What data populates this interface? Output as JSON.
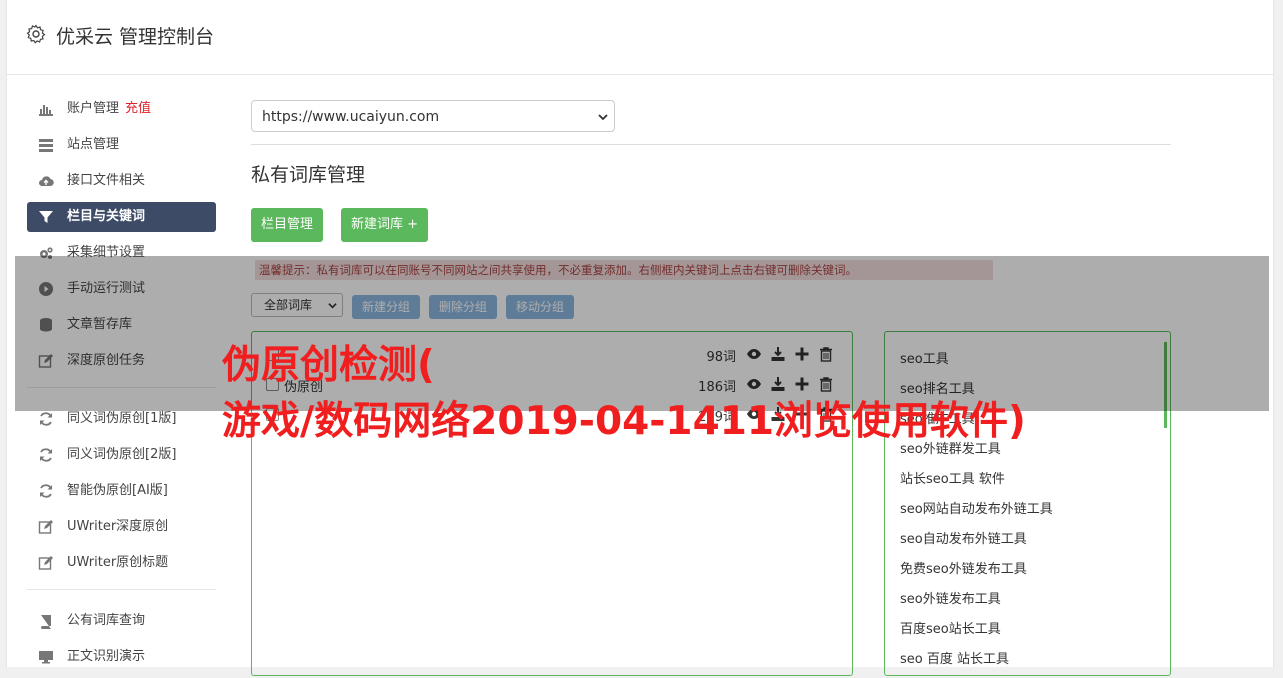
{
  "header": {
    "title": "优采云 管理控制台"
  },
  "sidebar": {
    "items": [
      {
        "label": "账户管理",
        "badge": "充值",
        "icon": "bar-chart-icon"
      },
      {
        "label": "站点管理",
        "icon": "server-icon"
      },
      {
        "label": "接口文件相关",
        "icon": "cloud-upload-icon"
      },
      {
        "label": "栏目与关键词",
        "icon": "filter-icon",
        "active": true
      },
      {
        "label": "采集细节设置",
        "icon": "gears-icon"
      },
      {
        "label": "手动运行测试",
        "icon": "play-circle-icon"
      },
      {
        "label": "文章暂存库",
        "icon": "database-icon"
      },
      {
        "label": "深度原创任务",
        "icon": "edit-icon"
      },
      {
        "label": "同义词伪原创[1版]",
        "icon": "refresh-icon"
      },
      {
        "label": "同义词伪原创[2版]",
        "icon": "refresh-icon"
      },
      {
        "label": "智能伪原创[AI版]",
        "icon": "refresh-icon"
      },
      {
        "label": "UWriter深度原创",
        "icon": "edit-icon"
      },
      {
        "label": "UWriter原创标题",
        "icon": "edit-icon"
      },
      {
        "label": "公有词库查询",
        "icon": "book-icon"
      },
      {
        "label": "正文识别演示",
        "icon": "monitor-icon"
      }
    ]
  },
  "main": {
    "site_select": "https://www.ucaiyun.com",
    "section_title": "私有词库管理",
    "btn_column": "栏目管理",
    "btn_new_lib": "新建词库 +",
    "tip": "温馨提示：私有词库可以在同账号不同网站之间共享使用，不必重复添加。右侧框内关键词上点击右键可删除关键词。",
    "lib_select": "全部词库",
    "btn_new_group": "新建分组",
    "btn_delete_group": "删除分组",
    "btn_move_group": "移动分组",
    "groups": [
      {
        "name": "",
        "count": "98词"
      },
      {
        "name": "伪原创",
        "count": "186词"
      },
      {
        "name": "",
        "count": "259词"
      }
    ],
    "keywords": [
      "seo工具",
      "seo排名工具",
      "seo推广工具",
      "seo外链群发工具",
      "站长seo工具 软件",
      "seo网站自动发布外链工具",
      "seo自动发布外链工具",
      "免费seo外链发布工具",
      "seo外链发布工具",
      "百度seo站长工具",
      "seo 百度 站长工具"
    ]
  },
  "overlay": {
    "line1": "伪原创检测(",
    "line2": "游戏/数码网络2019-04-1411浏览使用软件)"
  },
  "colors": {
    "active_nav": "#3d4b66",
    "green": "#5cb85c",
    "light_blue": "#8bb7e0",
    "overlay_red": "#f01e1e"
  }
}
